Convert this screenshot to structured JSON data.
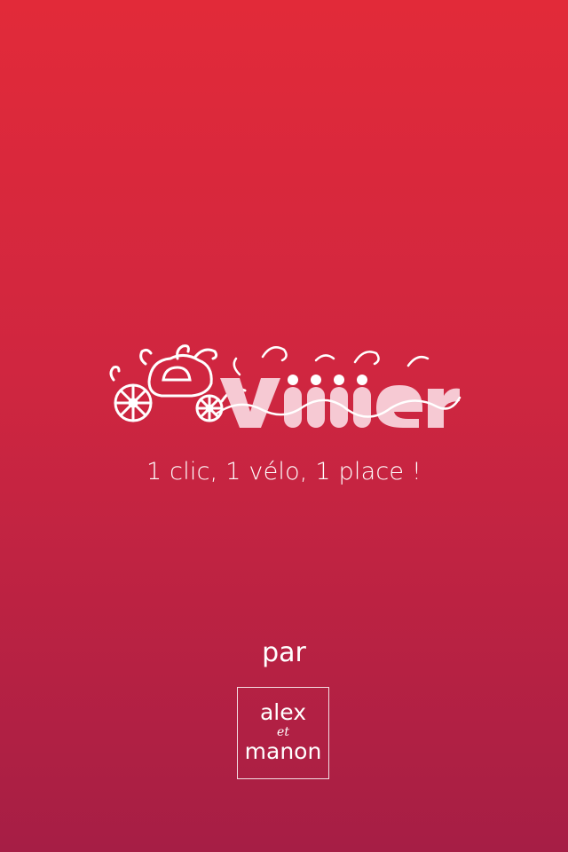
{
  "app": {
    "logo_word": "Vliiier",
    "tagline": "1 clic, 1 vélo, 1 place !",
    "by_label": "par",
    "brand": {
      "line1": "alex",
      "line2": "et",
      "line3": "manon"
    }
  },
  "colors": {
    "gradient_top": "#e22a39",
    "gradient_bottom": "#a61e45",
    "text": "#ffffff",
    "logo_pink": "#f6c9d3"
  },
  "icons": {
    "carriage": "pumpkin-carriage-icon"
  }
}
